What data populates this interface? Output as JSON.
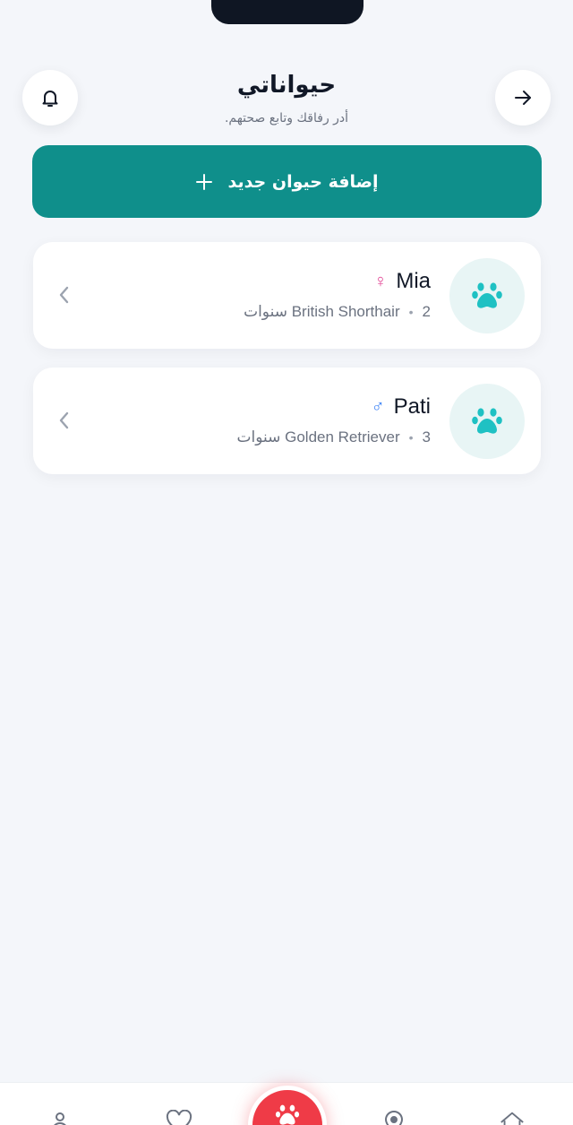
{
  "header": {
    "title": "حيواناتي",
    "subtitle": "أدر رفاقك وتابع صحتهم."
  },
  "add_button": {
    "label": "إضافة حيوان جديد"
  },
  "pets": [
    {
      "name": "Mia",
      "gender": "♀",
      "age": "2",
      "breed_line": "British Shorthair سنوات",
      "separator": "•"
    },
    {
      "name": "Pati",
      "gender": "♂",
      "age": "3",
      "breed_line": "Golden Retriever سنوات",
      "separator": "•"
    }
  ],
  "icons": {
    "header_left": "bell-icon",
    "header_right": "arrow-right-icon",
    "add": "plus-icon",
    "avatar": "paw-icon",
    "row": "chevron-left-icon",
    "nav": [
      "user-icon",
      "heart-icon",
      "paw-icon",
      "location-icon",
      "home-icon"
    ]
  },
  "colors": {
    "accent": "#0f8f8b",
    "paw": "#1fc1c3",
    "fab": "#ef3b47",
    "female": "#e24594",
    "male": "#3b82f6",
    "background": "#f4f6fa"
  }
}
